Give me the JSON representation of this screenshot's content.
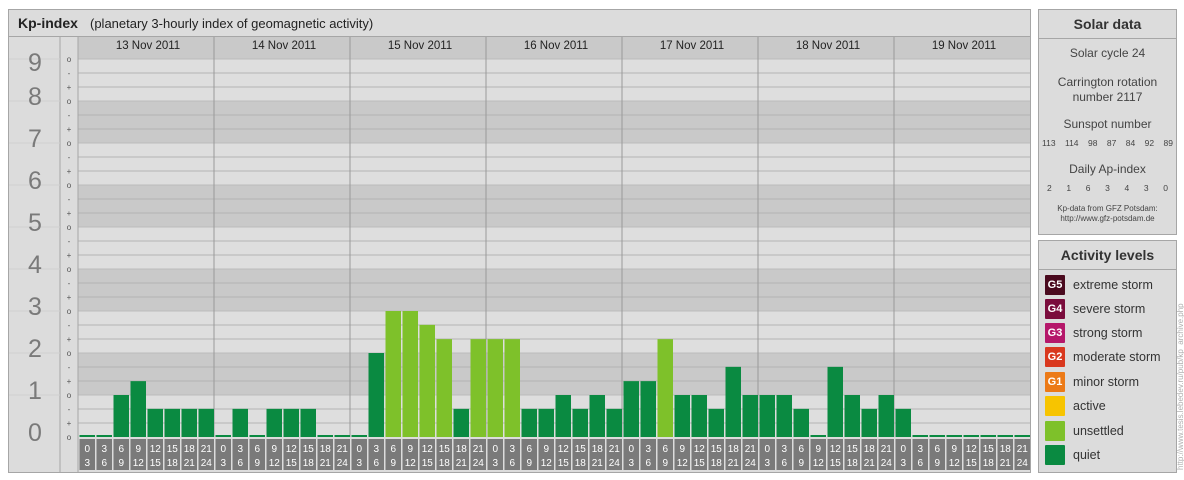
{
  "header": {
    "title": "Kp-index",
    "subtitle": "(planetary 3-hourly index of geomagnetic activity)"
  },
  "chart_data": {
    "type": "bar",
    "title": "Kp-index",
    "subtitle": "(planetary 3-hourly index of geomagnetic activity)",
    "ylim": [
      0,
      9
    ],
    "y_major_ticks": [
      "0",
      "1",
      "2",
      "3",
      "4",
      "5",
      "6",
      "7",
      "8",
      "9"
    ],
    "y_minor_labels": [
      "o",
      "+",
      "-"
    ],
    "days": [
      "13 Nov 2011",
      "14 Nov 2011",
      "15 Nov 2011",
      "16 Nov 2011",
      "17 Nov 2011",
      "18 Nov 2011",
      "19 Nov 2011"
    ],
    "interval_starts": [
      "0",
      "3",
      "6",
      "9",
      "12",
      "15",
      "18",
      "21"
    ],
    "interval_ends": [
      "3",
      "6",
      "9",
      "12",
      "15",
      "18",
      "21",
      "24"
    ],
    "values": [
      [
        0,
        0,
        1,
        1.33,
        0.67,
        0.67,
        0.67,
        0.67
      ],
      [
        0,
        0.67,
        0,
        0.67,
        0.67,
        0.67,
        0,
        0
      ],
      [
        0,
        2,
        3,
        3,
        2.67,
        2.33,
        0.67,
        2.33
      ],
      [
        2.33,
        2.33,
        0.67,
        0.67,
        1,
        0.67,
        1,
        0.67
      ],
      [
        1.33,
        1.33,
        2.33,
        1,
        1,
        0.67,
        1.67,
        1
      ],
      [
        1,
        1,
        0.67,
        0,
        1.67,
        1,
        0.67,
        1
      ],
      [
        0.67,
        0,
        0,
        0,
        0,
        0,
        0,
        0
      ]
    ],
    "levels": [
      [
        "quiet",
        "quiet",
        "quiet",
        "quiet",
        "quiet",
        "quiet",
        "quiet",
        "quiet"
      ],
      [
        "quiet",
        "quiet",
        "quiet",
        "quiet",
        "quiet",
        "quiet",
        "quiet",
        "quiet"
      ],
      [
        "quiet",
        "quiet",
        "unsettled",
        "unsettled",
        "unsettled",
        "unsettled",
        "quiet",
        "unsettled"
      ],
      [
        "unsettled",
        "unsettled",
        "quiet",
        "quiet",
        "quiet",
        "quiet",
        "quiet",
        "quiet"
      ],
      [
        "quiet",
        "quiet",
        "unsettled",
        "quiet",
        "quiet",
        "quiet",
        "quiet",
        "quiet"
      ],
      [
        "quiet",
        "quiet",
        "quiet",
        "quiet",
        "quiet",
        "quiet",
        "quiet",
        "quiet"
      ],
      [
        "quiet",
        "quiet",
        "quiet",
        "quiet",
        "quiet",
        "quiet",
        "quiet",
        "quiet"
      ]
    ],
    "colors": {
      "quiet": "#0a8a41",
      "unsettled": "#7ec12a"
    }
  },
  "solar": {
    "title": "Solar data",
    "cycle": "Solar cycle 24",
    "carrington_line1": "Carrington rotation",
    "carrington_line2": "number 2117",
    "sunspot_label": "Sunspot number",
    "sunspot_values": [
      "113",
      "114",
      "98",
      "87",
      "84",
      "92",
      "89"
    ],
    "ap_label": "Daily Ap-index",
    "ap_values": [
      "2",
      "1",
      "6",
      "3",
      "4",
      "3",
      "0"
    ],
    "source_line1": "Kp-data from GFZ Potsdam:",
    "source_line2": "http://www.gfz-potsdam.de"
  },
  "activity": {
    "title": "Activity levels",
    "items": [
      {
        "code": "G5",
        "label": "extreme storm",
        "color": "#4a0a1e"
      },
      {
        "code": "G4",
        "label": "severe storm",
        "color": "#7a0c3c"
      },
      {
        "code": "G3",
        "label": "strong storm",
        "color": "#b5176a"
      },
      {
        "code": "G2",
        "label": "moderate storm",
        "color": "#d9381e"
      },
      {
        "code": "G1",
        "label": "minor storm",
        "color": "#ec7a17"
      },
      {
        "code": "",
        "label": "active",
        "color": "#f7c400"
      },
      {
        "code": "",
        "label": "unsettled",
        "color": "#7ec12a"
      },
      {
        "code": "",
        "label": "quiet",
        "color": "#0a8a41"
      }
    ]
  },
  "watermark": "http://www.tesis.lebedev.ru/pub/kp_archive.php"
}
